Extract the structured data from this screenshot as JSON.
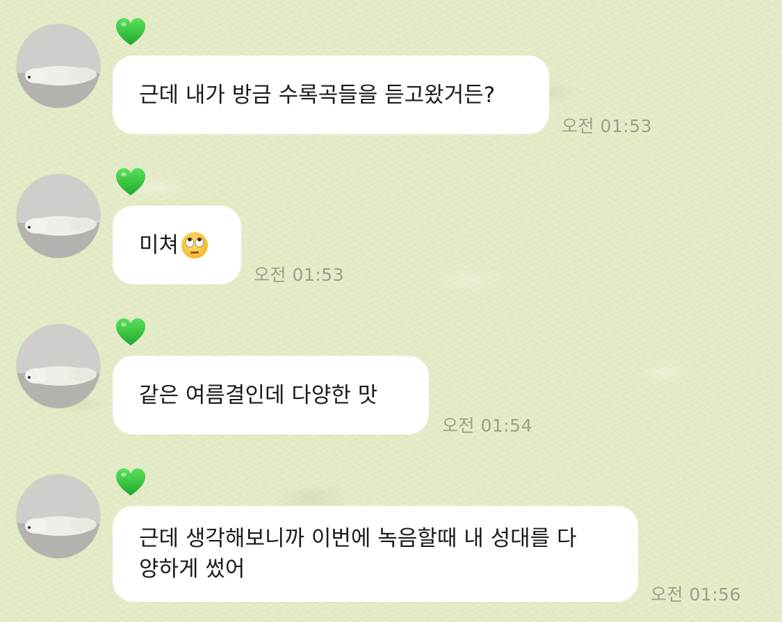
{
  "chat": {
    "messages": [
      {
        "text": "근데 내가 방금 수록곡들을 듣고왔거든?",
        "time": "오전 01:53"
      },
      {
        "text": "미쳐",
        "emoji": "face-with-rolling-eyes",
        "time": "오전 01:53"
      },
      {
        "text": "같은 여름결인데 다양한 맛",
        "time": "오전 01:54"
      },
      {
        "text": "근데 생각해보니까 이번에 녹음할때 내 성대를 다 양하게 썼어",
        "line1": "근데 생각해보니까 이번에 녹음할때 내 성대를 다",
        "line2": "양하게 썼어",
        "time": "오전 01:56"
      }
    ],
    "sender_badge_icon": "green-heart-icon",
    "colors": {
      "background": "#e3ebc6",
      "bubble": "#ffffff",
      "heart": "#2ecc40",
      "timestamp": "#9aa08c"
    }
  }
}
